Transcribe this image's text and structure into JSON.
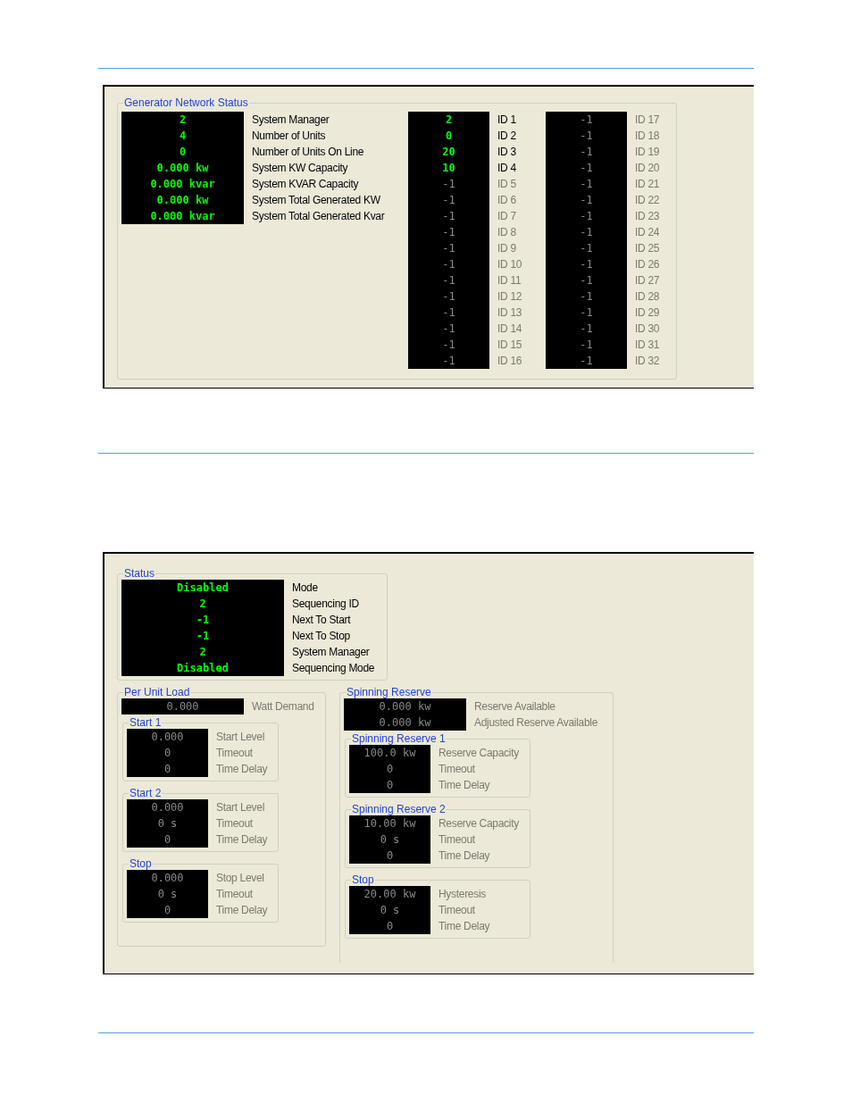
{
  "network_status": {
    "title": "Generator Network Status",
    "readings": [
      {
        "value": "2",
        "label": "System Manager",
        "disabled": false
      },
      {
        "value": "4",
        "label": "Number of Units",
        "disabled": false
      },
      {
        "value": "0",
        "label": "Number of Units On Line",
        "disabled": false
      },
      {
        "value": "0.000 kw",
        "label": "System KW Capacity",
        "disabled": false
      },
      {
        "value": "0.000 kvar",
        "label": "System KVAR Capacity",
        "disabled": false
      },
      {
        "value": "0.000 kw",
        "label": "System Total Generated KW",
        "disabled": false
      },
      {
        "value": "0.000 kvar",
        "label": "System Total Generated Kvar",
        "disabled": false
      }
    ],
    "ids_column_1": [
      {
        "value": "2",
        "label": "ID 1",
        "disabled": false
      },
      {
        "value": "0",
        "label": "ID 2",
        "disabled": false
      },
      {
        "value": "20",
        "label": "ID 3",
        "disabled": false
      },
      {
        "value": "10",
        "label": "ID 4",
        "disabled": false
      },
      {
        "value": "-1",
        "label": "ID 5",
        "disabled": true
      },
      {
        "value": "-1",
        "label": "ID 6",
        "disabled": true
      },
      {
        "value": "-1",
        "label": "ID 7",
        "disabled": true
      },
      {
        "value": "-1",
        "label": "ID 8",
        "disabled": true
      },
      {
        "value": "-1",
        "label": "ID 9",
        "disabled": true
      },
      {
        "value": "-1",
        "label": "ID 10",
        "disabled": true
      },
      {
        "value": "-1",
        "label": "ID 11",
        "disabled": true
      },
      {
        "value": "-1",
        "label": "ID 12",
        "disabled": true
      },
      {
        "value": "-1",
        "label": "ID 13",
        "disabled": true
      },
      {
        "value": "-1",
        "label": "ID 14",
        "disabled": true
      },
      {
        "value": "-1",
        "label": "ID 15",
        "disabled": true
      },
      {
        "value": "-1",
        "label": "ID 16",
        "disabled": true
      }
    ],
    "ids_column_2": [
      {
        "value": "-1",
        "label": "ID 17",
        "disabled": true
      },
      {
        "value": "-1",
        "label": "ID 18",
        "disabled": true
      },
      {
        "value": "-1",
        "label": "ID 19",
        "disabled": true
      },
      {
        "value": "-1",
        "label": "ID 20",
        "disabled": true
      },
      {
        "value": "-1",
        "label": "ID 21",
        "disabled": true
      },
      {
        "value": "-1",
        "label": "ID 22",
        "disabled": true
      },
      {
        "value": "-1",
        "label": "ID 23",
        "disabled": true
      },
      {
        "value": "-1",
        "label": "ID 24",
        "disabled": true
      },
      {
        "value": "-1",
        "label": "ID 25",
        "disabled": true
      },
      {
        "value": "-1",
        "label": "ID 26",
        "disabled": true
      },
      {
        "value": "-1",
        "label": "ID 27",
        "disabled": true
      },
      {
        "value": "-1",
        "label": "ID 28",
        "disabled": true
      },
      {
        "value": "-1",
        "label": "ID 29",
        "disabled": true
      },
      {
        "value": "-1",
        "label": "ID 30",
        "disabled": true
      },
      {
        "value": "-1",
        "label": "ID 31",
        "disabled": true
      },
      {
        "value": "-1",
        "label": "ID 32",
        "disabled": true
      }
    ]
  },
  "status": {
    "title": "Status",
    "rows": [
      {
        "value": "Disabled",
        "label": "Mode",
        "disabled": false
      },
      {
        "value": "2",
        "label": "Sequencing ID",
        "disabled": false
      },
      {
        "value": "-1",
        "label": "Next To Start",
        "disabled": false
      },
      {
        "value": "-1",
        "label": "Next To Stop",
        "disabled": false
      },
      {
        "value": "2",
        "label": "System Manager",
        "disabled": false
      },
      {
        "value": "Disabled",
        "label": "Sequencing Mode",
        "disabled": false
      }
    ]
  },
  "per_unit_load": {
    "title": "Per Unit Load",
    "rows": [
      {
        "value": "0.000",
        "label": "Watt Demand",
        "disabled": true
      }
    ],
    "groups": [
      {
        "title": "Start 1",
        "rows": [
          {
            "value": "0.000",
            "label": "Start Level",
            "disabled": true
          },
          {
            "value": "0",
            "label": "Timeout",
            "disabled": true
          },
          {
            "value": "0",
            "label": "Time Delay",
            "disabled": true
          }
        ]
      },
      {
        "title": "Start 2",
        "rows": [
          {
            "value": "0.000",
            "label": "Start Level",
            "disabled": true
          },
          {
            "value": "0 s",
            "label": "Timeout",
            "disabled": true
          },
          {
            "value": "0",
            "label": "Time Delay",
            "disabled": true
          }
        ]
      },
      {
        "title": "Stop",
        "rows": [
          {
            "value": "0.000",
            "label": "Stop Level",
            "disabled": true
          },
          {
            "value": "0 s",
            "label": "Timeout",
            "disabled": true
          },
          {
            "value": "0",
            "label": "Time Delay",
            "disabled": true
          }
        ]
      }
    ]
  },
  "spinning_reserve": {
    "title": "Spinning Reserve",
    "rows": [
      {
        "value": "0.000 kw",
        "label": "Reserve Available",
        "disabled": true
      },
      {
        "value": "0.000 kw",
        "label": "Adjusted Reserve Available",
        "disabled": true
      }
    ],
    "groups": [
      {
        "title": "Spinning Reserve 1",
        "rows": [
          {
            "value": "100.0 kw",
            "label": "Reserve Capacity",
            "disabled": true
          },
          {
            "value": "0",
            "label": "Timeout",
            "disabled": true
          },
          {
            "value": "0",
            "label": "Time Delay",
            "disabled": true
          }
        ]
      },
      {
        "title": "Spinning Reserve 2",
        "rows": [
          {
            "value": "10.00 kw",
            "label": "Reserve Capacity",
            "disabled": true
          },
          {
            "value": "0 s",
            "label": "Timeout",
            "disabled": true
          },
          {
            "value": "0",
            "label": "Time Delay",
            "disabled": true
          }
        ]
      },
      {
        "title": "Stop",
        "rows": [
          {
            "value": "20.00 kw",
            "label": "Hysteresis",
            "disabled": true
          },
          {
            "value": "0 s",
            "label": "Timeout",
            "disabled": true
          },
          {
            "value": "0",
            "label": "Time Delay",
            "disabled": true
          }
        ]
      }
    ]
  }
}
